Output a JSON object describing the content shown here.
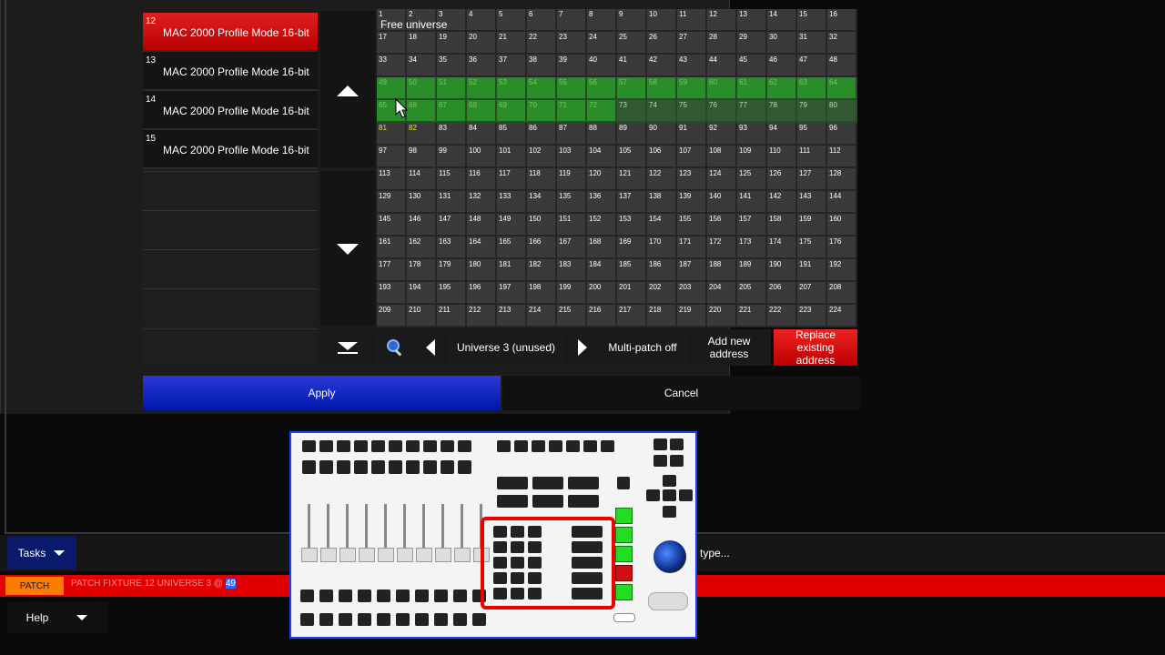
{
  "fixtures": [
    {
      "number": "12",
      "label": "MAC 2000 Profile Mode 16-bit"
    },
    {
      "number": "13",
      "label": "MAC 2000 Profile Mode 16-bit"
    },
    {
      "number": "14",
      "label": "MAC 2000 Profile Mode 16-bit"
    },
    {
      "number": "15",
      "label": "MAC 2000 Profile Mode 16-bit"
    }
  ],
  "grid": {
    "overlay_label": "Free universe",
    "patched_range": [
      49,
      80
    ],
    "patched_visible_end": 72,
    "conflict_cells": [
      81,
      82
    ],
    "columns": 16,
    "rows": 14
  },
  "toolbar": {
    "universe_label": "Universe 3 (unused)",
    "multipatch_label": "Multi-patch off",
    "add_label": "Add new address",
    "replace_label": "Replace existing address"
  },
  "dialog": {
    "apply_label": "Apply",
    "cancel_label": "Cancel"
  },
  "taskbar": {
    "tasks_label": "Tasks",
    "help_label": "Help",
    "patch_label": "PATCH",
    "command_text": "PATCH FIXTURE 12 UNIVERSE 3 @ ",
    "command_highlight": "49",
    "hint_text": "type..."
  },
  "colors": {
    "accent_red": "#e00000",
    "patched_green": "#2a8a2a",
    "apply_blue": "#1428c8",
    "patch_orange": "#ff7a00"
  }
}
